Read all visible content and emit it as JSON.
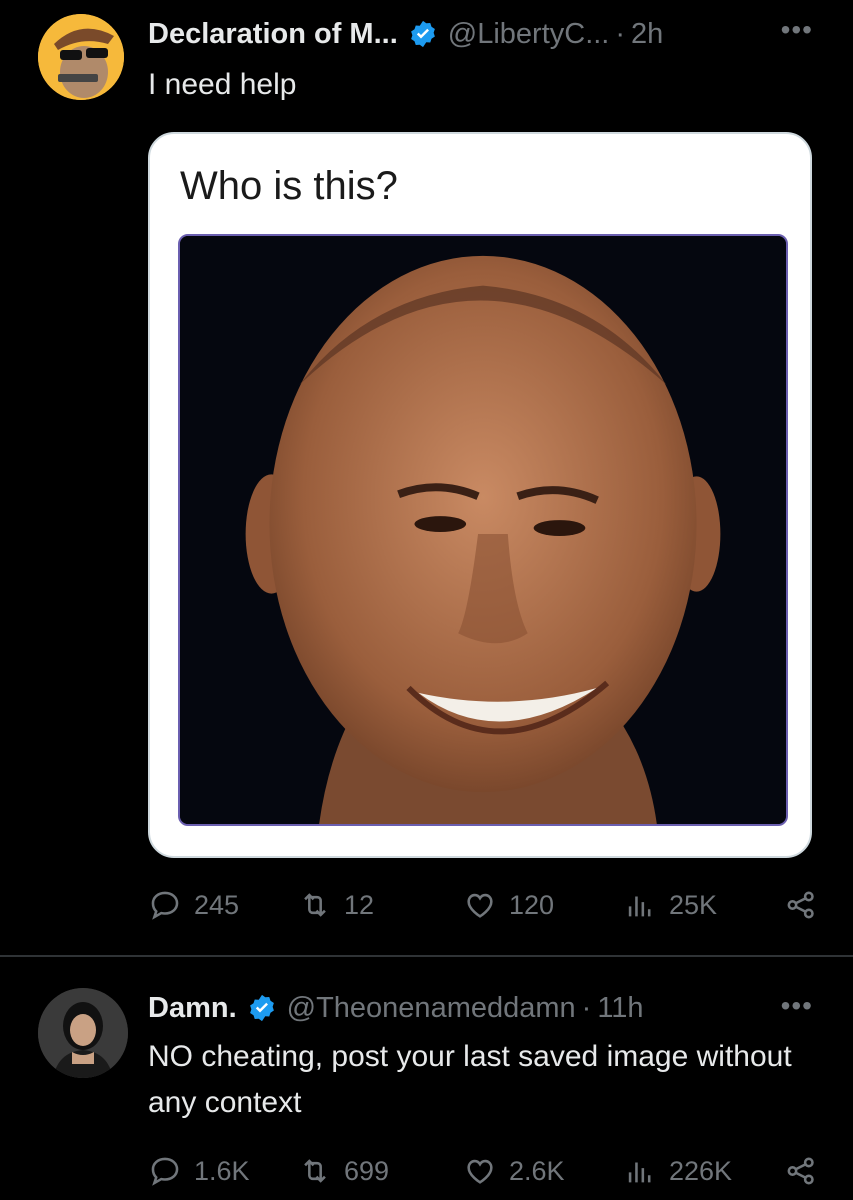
{
  "tweet1": {
    "name": "Declaration of M...",
    "handle": "@LibertyC...",
    "dot": "·",
    "time": "2h",
    "more": "•••",
    "text": "I need help",
    "card_question": "Who is this?",
    "stats": {
      "replies": "245",
      "retweets": "12",
      "likes": "120",
      "views": "25K"
    }
  },
  "tweet2": {
    "name": "Damn.",
    "handle": "@Theonenameddamn",
    "dot": "·",
    "time": "11h",
    "more": "•••",
    "text": "NO cheating, post your last saved image without any context",
    "stats": {
      "replies": "1.6K",
      "retweets": "699",
      "likes": "2.6K",
      "views": "226K"
    }
  },
  "colors": {
    "background": "#000000",
    "text": "#e7e9ea",
    "muted": "#71767b",
    "verified": "#1d9bf0",
    "divider": "#2f3336"
  }
}
